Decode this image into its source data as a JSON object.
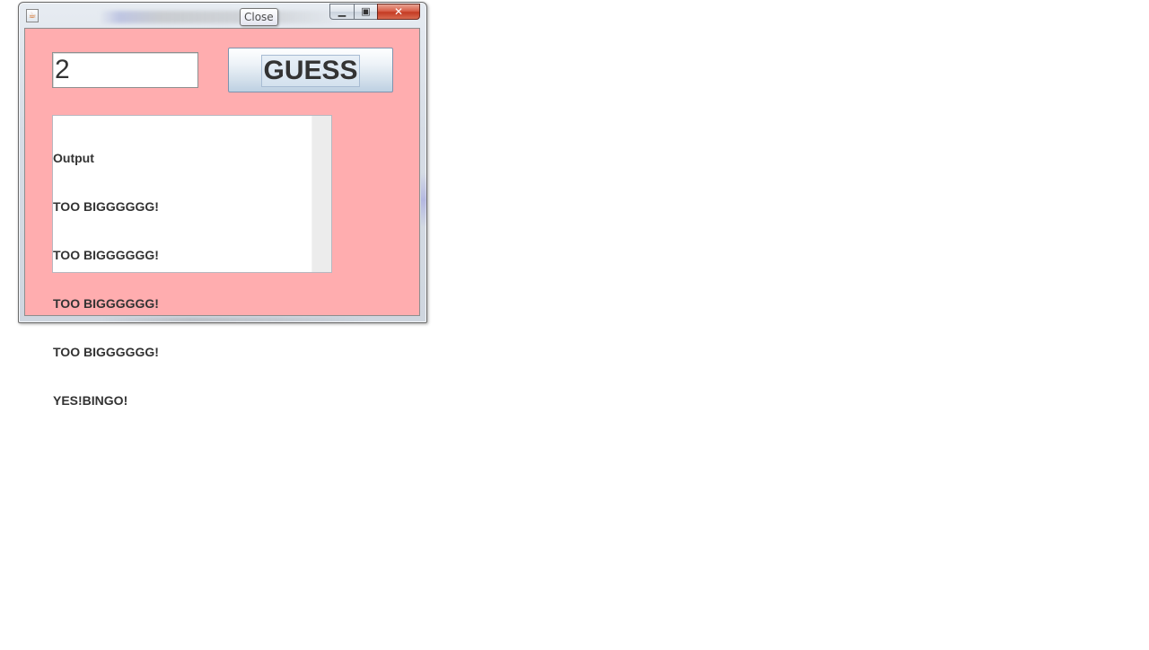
{
  "window": {
    "tooltip": "Close",
    "app_icon": "java-icon",
    "minimize_icon": "minimize-icon",
    "maximize_icon": "maximize-icon",
    "close_icon": "close-icon",
    "colors": {
      "content_background": "#ffadaf",
      "close_button": "#c43b23"
    }
  },
  "form": {
    "input_value": "2",
    "guess_label": "GUESS"
  },
  "output": {
    "lines": [
      "Output",
      "TOO BIGGGGGG!",
      "TOO BIGGGGGG!",
      "TOO BIGGGGGG!",
      "TOO BIGGGGGG!",
      "YES!BINGO!"
    ]
  }
}
